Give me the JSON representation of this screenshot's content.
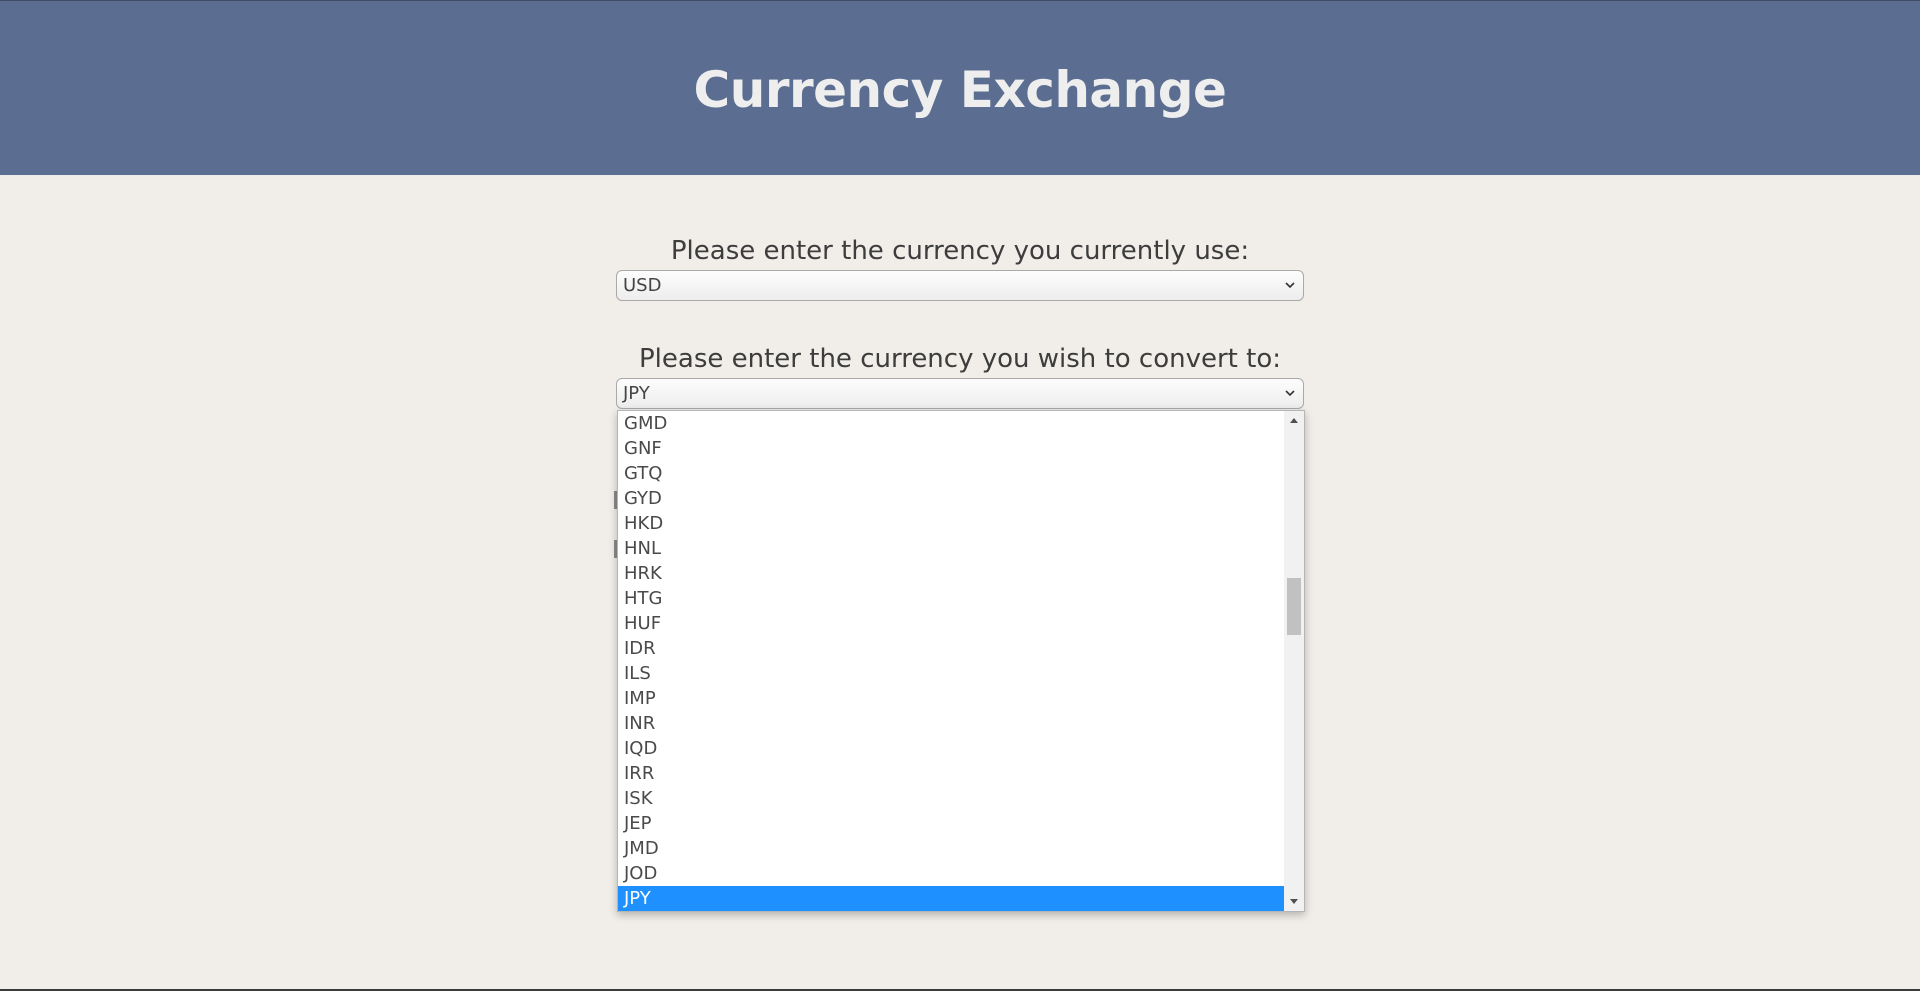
{
  "header": {
    "title": "Currency Exchange"
  },
  "form": {
    "from_label": "Please enter the currency you currently use:",
    "from_value": "USD",
    "to_label": "Please enter the currency you wish to convert to:",
    "to_value": "JPY"
  },
  "dropdown": {
    "options": [
      "GMD",
      "GNF",
      "GTQ",
      "GYD",
      "HKD",
      "HNL",
      "HRK",
      "HTG",
      "HUF",
      "IDR",
      "ILS",
      "IMP",
      "INR",
      "IQD",
      "IRR",
      "ISK",
      "JEP",
      "JMD",
      "JOD",
      "JPY"
    ],
    "selected": "JPY",
    "highlight_color": "#1e90ff"
  },
  "colors": {
    "header_bg": "#5b6e91",
    "page_bg": "#f1eee9"
  }
}
